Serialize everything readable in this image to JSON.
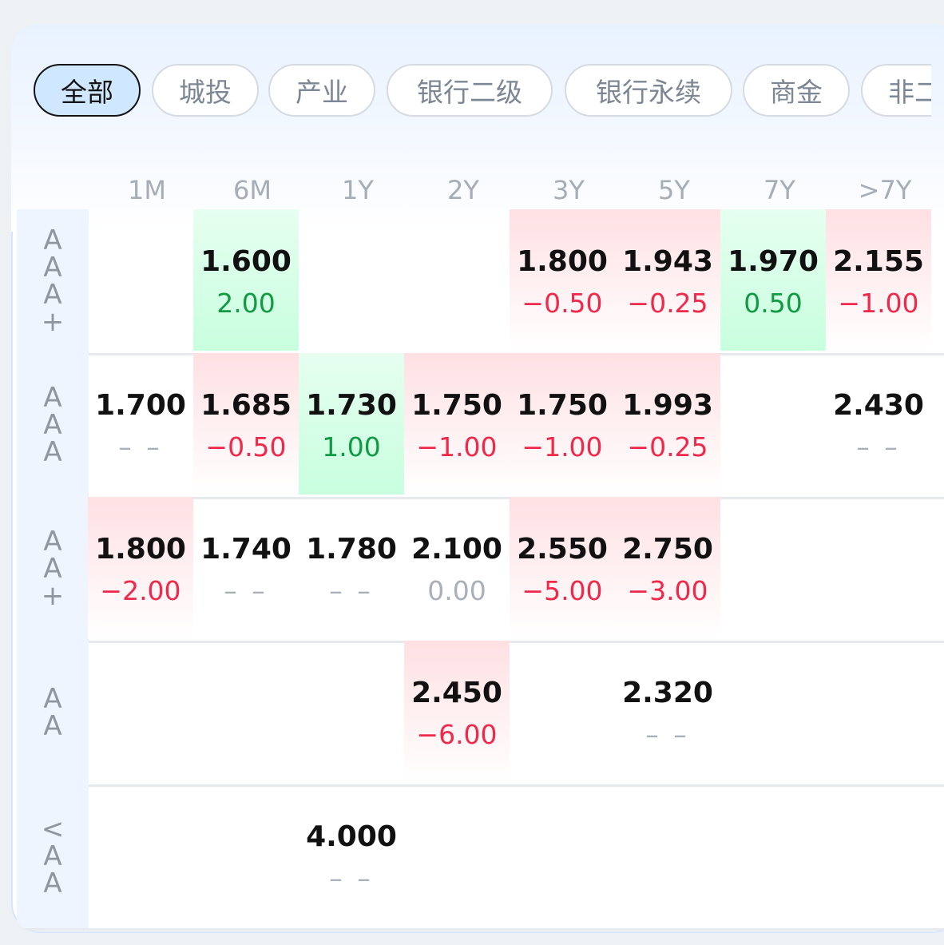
{
  "tabs": [
    "全部",
    "城投",
    "产业",
    "银行二级",
    "银行永续",
    "商金",
    "非二"
  ],
  "tab_active_index": 0,
  "columns": [
    "1M",
    "6M",
    "1Y",
    "2Y",
    "3Y",
    "5Y",
    "7Y",
    ">7Y"
  ],
  "rows": [
    {
      "label": [
        "A",
        "A",
        "A",
        "+"
      ],
      "cells": [
        null,
        {
          "value": "1.600",
          "change": "2.00",
          "tone": "green"
        },
        null,
        null,
        {
          "value": "1.800",
          "change": "−0.50",
          "tone": "red"
        },
        {
          "value": "1.943",
          "change": "−0.25",
          "tone": "red"
        },
        {
          "value": "1.970",
          "change": "0.50",
          "tone": "green"
        },
        {
          "value": "2.155",
          "change": "−1.00",
          "tone": "red"
        }
      ]
    },
    {
      "label": [
        "A",
        "A",
        "A"
      ],
      "cells": [
        {
          "value": "1.700",
          "change": "– –",
          "tone": "none"
        },
        {
          "value": "1.685",
          "change": "−0.50",
          "tone": "red"
        },
        {
          "value": "1.730",
          "change": "1.00",
          "tone": "green"
        },
        {
          "value": "1.750",
          "change": "−1.00",
          "tone": "red"
        },
        {
          "value": "1.750",
          "change": "−1.00",
          "tone": "red"
        },
        {
          "value": "1.993",
          "change": "−0.25",
          "tone": "red"
        },
        null,
        {
          "value": "2.430",
          "change": "– –",
          "tone": "none"
        }
      ]
    },
    {
      "label": [
        "A",
        "A",
        "+"
      ],
      "cells": [
        {
          "value": "1.800",
          "change": "−2.00",
          "tone": "red"
        },
        {
          "value": "1.740",
          "change": "– –",
          "tone": "none"
        },
        {
          "value": "1.780",
          "change": "– –",
          "tone": "none"
        },
        {
          "value": "2.100",
          "change": "0.00",
          "tone": "none"
        },
        {
          "value": "2.550",
          "change": "−5.00",
          "tone": "red"
        },
        {
          "value": "2.750",
          "change": "−3.00",
          "tone": "red"
        },
        null,
        null
      ]
    },
    {
      "label": [
        "A",
        "A"
      ],
      "cells": [
        null,
        null,
        null,
        {
          "value": "2.450",
          "change": "−6.00",
          "tone": "red"
        },
        null,
        {
          "value": "2.320",
          "change": "– –",
          "tone": "none"
        },
        null,
        null
      ]
    },
    {
      "label": [
        "<",
        "A",
        "A"
      ],
      "cells": [
        null,
        null,
        {
          "value": "4.000",
          "change": "– –",
          "tone": "none"
        },
        null,
        null,
        null,
        null,
        null
      ]
    }
  ],
  "colors": {
    "negative": "#f0284a",
    "positive": "#129a43",
    "neutral": "#a9b0bb",
    "active_tab_bg": "#cfe7ff"
  }
}
